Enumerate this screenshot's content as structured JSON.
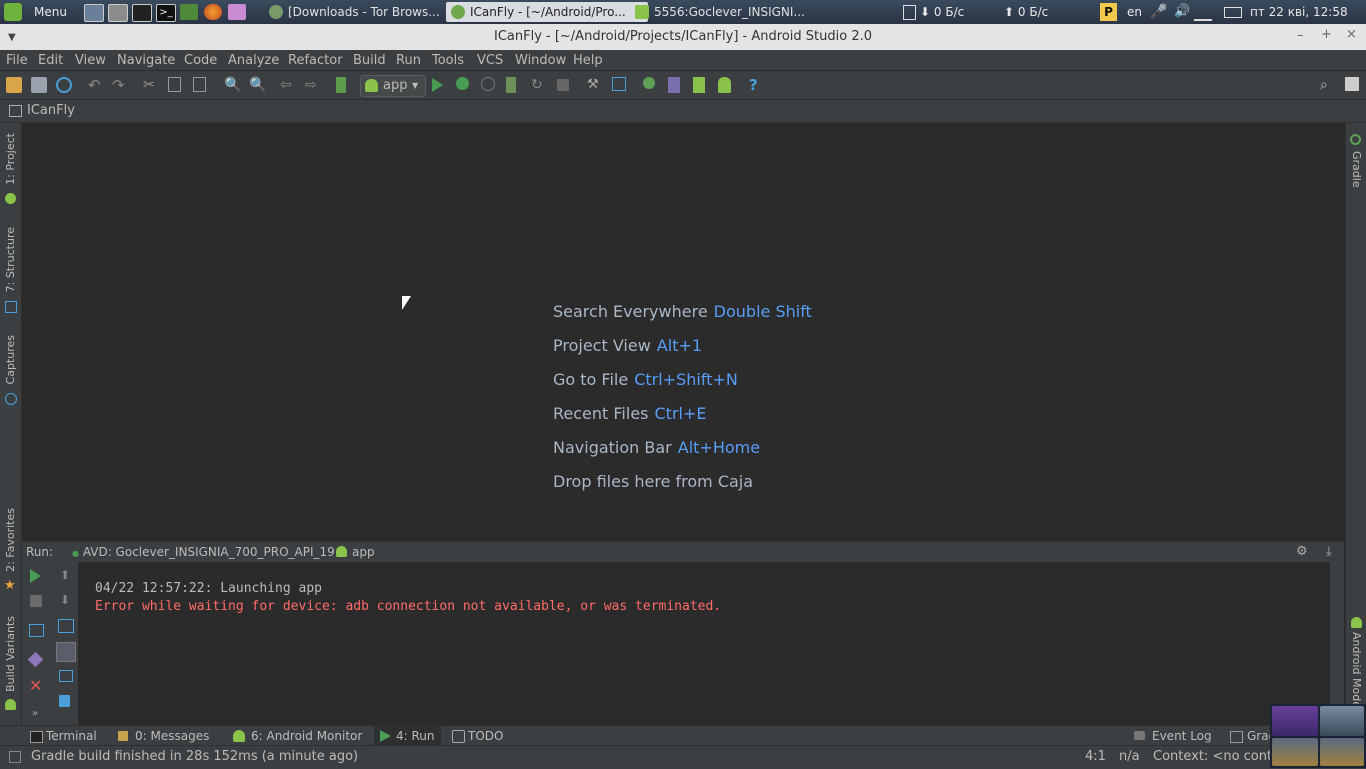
{
  "system_panel": {
    "menu_label": "Menu",
    "tasks": [
      {
        "label": "[Downloads - Tor Brows..."
      },
      {
        "label": "ICanFly - [~/Android/Pro..."
      },
      {
        "label": "5556:Goclever_INSIGNI..."
      }
    ],
    "net_down": "0 Б/с",
    "net_up": "0 Б/с",
    "keyboard_layout": "en",
    "clock": "пт 22 кві, 12:58"
  },
  "window": {
    "title": "ICanFly - [~/Android/Projects/ICanFly] - Android Studio 2.0"
  },
  "menubar": [
    "File",
    "Edit",
    "View",
    "Navigate",
    "Code",
    "Analyze",
    "Refactor",
    "Build",
    "Run",
    "Tools",
    "VCS",
    "Window",
    "Help"
  ],
  "toolbar": {
    "run_config": "app"
  },
  "breadcrumb": {
    "project": "ICanFly"
  },
  "left_tool_tabs": [
    "1: Project",
    "7: Structure",
    "Captures",
    "2: Favorites",
    "Build Variants"
  ],
  "right_tool_tabs": [
    "Gradle",
    "Android Model"
  ],
  "editor_hints": [
    {
      "label": "Search Everywhere",
      "key": "Double Shift"
    },
    {
      "label": "Project View",
      "key": "Alt+1"
    },
    {
      "label": "Go to File",
      "key": "Ctrl+Shift+N"
    },
    {
      "label": "Recent Files",
      "key": "Ctrl+E"
    },
    {
      "label": "Navigation Bar",
      "key": "Alt+Home"
    },
    {
      "label": "Drop files here from Caja",
      "key": ""
    }
  ],
  "run_panel": {
    "label": "Run:",
    "tab_avd": "AVD: Goclever_INSIGNIA_700_PRO_API_19",
    "tab_app": "app",
    "lines": [
      {
        "text": "04/22 12:57:22: Launching app",
        "color": "#bbbbbb"
      },
      {
        "text": "Error while waiting for device: adb connection not available, or was terminated.",
        "color": "#ff6b68"
      }
    ]
  },
  "bottom_tabs": {
    "terminal": "Terminal",
    "messages": "0: Messages",
    "android_monitor": "6: Android Monitor",
    "run": "4: Run",
    "todo": "TODO",
    "event_log": "Event Log",
    "gradle_console": "Gradle Console"
  },
  "status_bar": {
    "message": "Gradle build finished in 28s 152ms (a minute ago)",
    "position": "4:1",
    "encoding": "n/a",
    "context": "Context: <no context>"
  },
  "colors": {
    "accent_blue": "#589df6",
    "error_red": "#ff6b68",
    "run_green": "#499c54"
  }
}
